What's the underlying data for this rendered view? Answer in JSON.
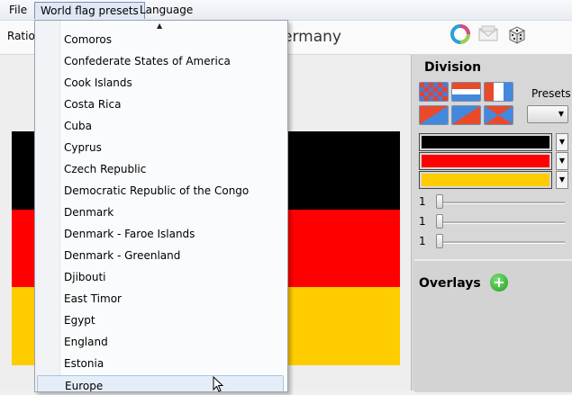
{
  "menubar": {
    "items": [
      {
        "label": "File"
      },
      {
        "label": "World flag presets"
      },
      {
        "label": "Language"
      }
    ]
  },
  "toolbar": {
    "ratio_label": "Ratio",
    "flag_title": "ermany",
    "icons": [
      "refresh-icon",
      "mail-icon",
      "dice-icon"
    ]
  },
  "flag": {
    "stripes": [
      "#000000",
      "#ff0000",
      "#ffcc00"
    ]
  },
  "dropdown": {
    "items": [
      "Comoros",
      "Confederate States of America",
      "Cook Islands",
      "Costa Rica",
      "Cuba",
      "Cyprus",
      "Czech Republic",
      "Democratic Republic of the Congo",
      "Denmark",
      "Denmark - Faroe Islands",
      "Denmark - Greenland",
      "Djibouti",
      "East Timor",
      "Egypt",
      "England",
      "Estonia",
      "Europe"
    ],
    "hovered": "Europe"
  },
  "panel": {
    "division_title": "Division",
    "presets_label": "Presets",
    "colors": [
      "#000000",
      "#ff0000",
      "#ffcc00"
    ],
    "sliders": [
      {
        "value": "1"
      },
      {
        "value": "1"
      },
      {
        "value": "1"
      }
    ],
    "overlays_title": "Overlays",
    "add_symbol": "+"
  }
}
